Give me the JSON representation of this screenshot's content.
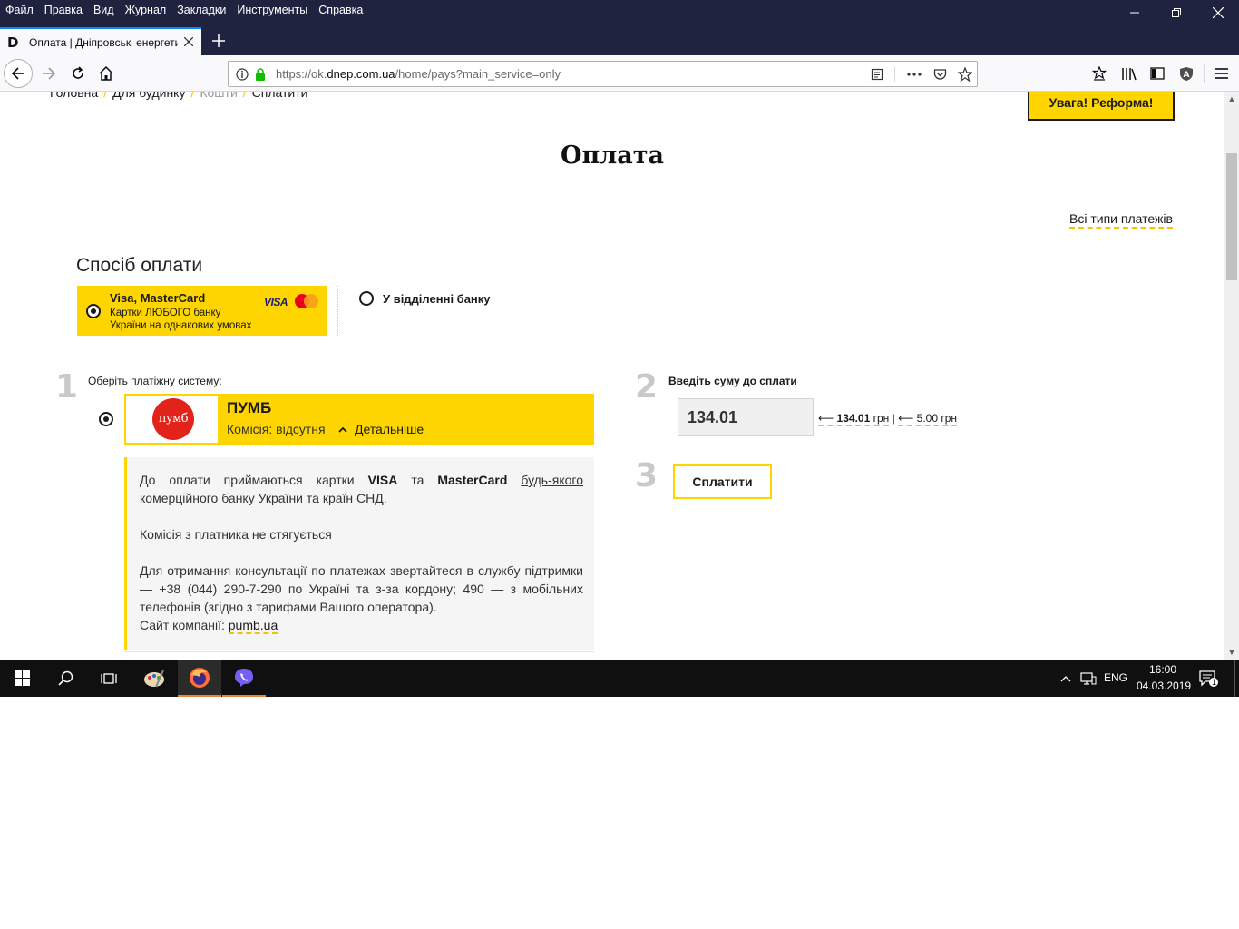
{
  "menu": [
    "Файл",
    "Правка",
    "Вид",
    "Журнал",
    "Закладки",
    "Инструменты",
    "Справка"
  ],
  "tab": {
    "title": "Оплата | Дніпровські енергети"
  },
  "address": {
    "scheme": "https://ok.",
    "domain": "dnep.com.ua",
    "path": "/home/pays?main_service=only"
  },
  "breadcrumb": [
    "Головна",
    "Для будинку",
    "Кошти",
    "Сплатити"
  ],
  "alert_button": "Увага! Реформа!",
  "page_title": "Оплата",
  "all_types_link": "Всі типи платежів",
  "payment_method": {
    "title": "Спосіб оплати",
    "card": {
      "title": "Visa, MasterCard",
      "line1": "Картки ЛЮБОГО банку",
      "line2": "України на однакових умовах",
      "visa": "VISA"
    },
    "bank": "У відділенні банку"
  },
  "step1": {
    "num": "1",
    "label": "Оберіть платіжну систему:"
  },
  "pumb": {
    "logo": "пумб",
    "name": "ПУМБ",
    "fee": "Комісія: відсутня",
    "details": "Детальніше",
    "info": {
      "p1_a": "До оплати приймаються картки",
      "p1_visa": "VISA",
      "p1_and": "та",
      "p1_mc": "MasterCard",
      "p1_any": "будь-якого",
      "p1_b": "комерційного банку України та країн СНД.",
      "p2": "Комісія з платника не стягується",
      "p3": "Для отримання консультації по платежах звертайтеся в службу підтримки — +38 (044) 290-7-290 по Україні та з-за кордону; 490 — з мобільних телефонів (згідно з тарифами Вашого оператора).",
      "site_label": "Сайт компанії:",
      "site_link": "pumb.ua"
    }
  },
  "step2": {
    "num": "2",
    "label": "Введіть суму до сплати",
    "amount": "134.01",
    "hint1_value": "134.01",
    "hint1_unit": "грн",
    "hint_sep": "|",
    "hint2": "5.00 грн"
  },
  "step3": {
    "num": "3",
    "pay_button": "Сплатити"
  },
  "taskbar": {
    "lang": "ENG",
    "time": "16:00",
    "date": "04.03.2019",
    "notif_count": "1"
  }
}
